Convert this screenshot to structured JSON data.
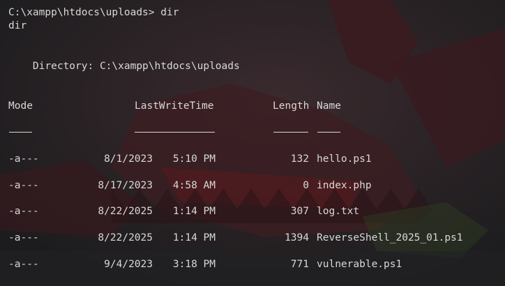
{
  "terminal": {
    "prompt_line": "C:\\xampp\\htdocs\\uploads> dir",
    "echo_line": "dir",
    "directory_line": "    Directory: C:\\xampp\\htdocs\\uploads",
    "headers": {
      "mode": "Mode",
      "lastwritetime": "LastWriteTime",
      "length": "Length",
      "name": "Name"
    },
    "rows": [
      {
        "mode": "-a---",
        "date": "8/1/2023",
        "time": "5:10 PM",
        "length": "132",
        "name": "hello.ps1"
      },
      {
        "mode": "-a---",
        "date": "8/17/2023",
        "time": "4:58 AM",
        "length": "0",
        "name": "index.php"
      },
      {
        "mode": "-a---",
        "date": "8/22/2025",
        "time": "1:14 PM",
        "length": "307",
        "name": "log.txt"
      },
      {
        "mode": "-a---",
        "date": "8/22/2025",
        "time": "1:14 PM",
        "length": "1394",
        "name": "ReverseShell_2025_01.ps1"
      },
      {
        "mode": "-a---",
        "date": "9/4/2023",
        "time": "3:18 PM",
        "length": "771",
        "name": "vulnerable.ps1"
      }
    ]
  },
  "colors": {
    "background": "#1f1f21",
    "text": "#d8d8d8",
    "wallpaper_red": "#5a1a1e",
    "wallpaper_dark": "#2a2a2e"
  }
}
